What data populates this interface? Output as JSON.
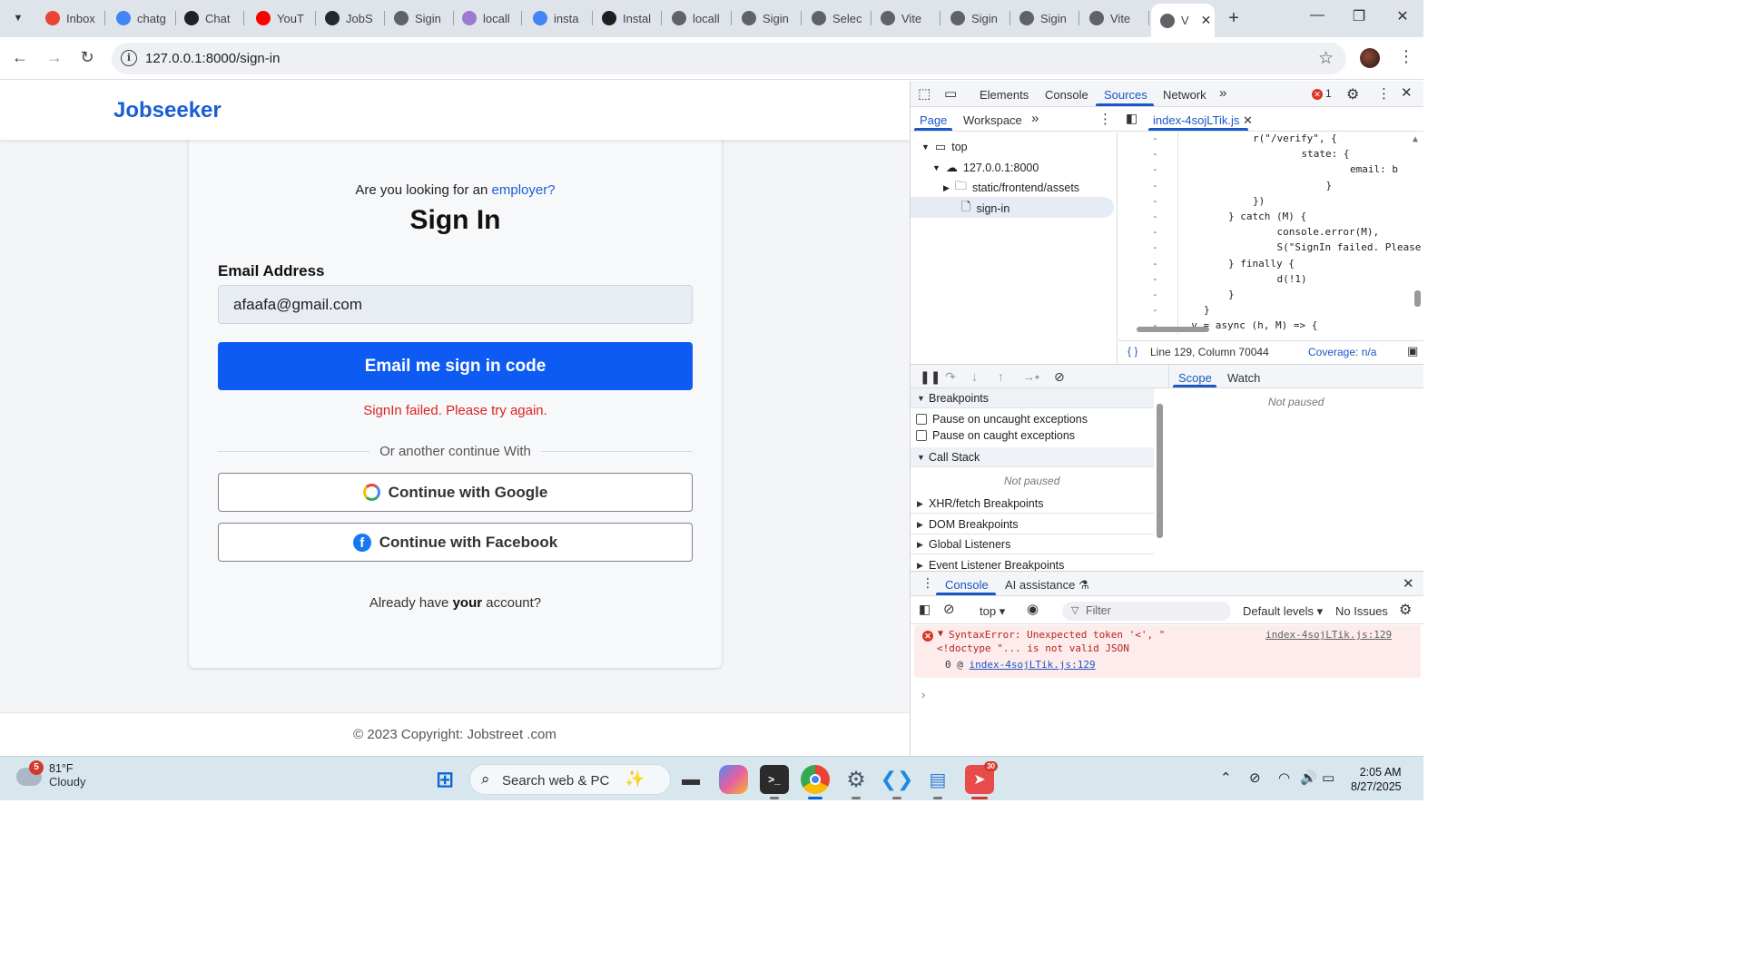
{
  "browser": {
    "tabs": [
      {
        "label": "Inbox",
        "icon": "gmail-icon",
        "color": "#ea4335"
      },
      {
        "label": "chatg",
        "icon": "google-icon",
        "color": "#4285f4"
      },
      {
        "label": "Chat",
        "icon": "openai-icon",
        "color": "#202123"
      },
      {
        "label": "YouT",
        "icon": "youtube-icon",
        "color": "#ff0000"
      },
      {
        "label": "JobS",
        "icon": "github-icon",
        "color": "#24292f"
      },
      {
        "label": "Sigin",
        "icon": "globe-icon",
        "color": "#5f6368"
      },
      {
        "label": "locall",
        "icon": "vite-icon",
        "color": "#9a7bd0"
      },
      {
        "label": "insta",
        "icon": "google-icon",
        "color": "#4285f4"
      },
      {
        "label": "Instal",
        "icon": "render-icon",
        "color": "#1e1e1e"
      },
      {
        "label": "locall",
        "icon": "globe-icon",
        "color": "#5f6368"
      },
      {
        "label": "Sigin",
        "icon": "globe-icon",
        "color": "#5f6368"
      },
      {
        "label": "Selec",
        "icon": "globe-icon",
        "color": "#5f6368"
      },
      {
        "label": "Vite",
        "icon": "globe-icon",
        "color": "#5f6368"
      },
      {
        "label": "Sigin",
        "icon": "globe-icon",
        "color": "#5f6368"
      },
      {
        "label": "Sigin",
        "icon": "globe-icon",
        "color": "#5f6368"
      },
      {
        "label": "Vite",
        "icon": "globe-icon",
        "color": "#5f6368"
      }
    ],
    "active_tab": {
      "label": "V",
      "icon": "globe-icon"
    },
    "url": "127.0.0.1:8000/sign-in"
  },
  "site": {
    "brand": "Jobseeker",
    "question_prefix": "Are you looking for an ",
    "question_link": "employer?",
    "title": "Sign In",
    "email_label": "Email Address",
    "email_value": "afaafa@gmail.com",
    "primary_button": "Email me sign in code",
    "error": "SignIn failed. Please try again.",
    "divider_text": "Or another continue With",
    "google_button": "Continue with Google",
    "facebook_button": "Continue with Facebook",
    "already_prefix": "Already have ",
    "already_bold": "your",
    "already_suffix": " account?",
    "footer": "© 2023 Copyright: Jobstreet .com",
    "accent_color": "#0d5bf2",
    "brand_color": "#1a5ed8",
    "error_color": "#dd2222"
  },
  "devtools": {
    "tabs": [
      "Elements",
      "Console",
      "Sources",
      "Network"
    ],
    "active_tab": "Sources",
    "error_count": "1",
    "nav_tabs": [
      "Page",
      "Workspace"
    ],
    "open_file": "index-4sojLTik.js",
    "tree": {
      "top": "top",
      "origin": "127.0.0.1:8000",
      "folder": "static/frontend/assets",
      "file": "sign-in"
    },
    "code_lines": [
      {
        "dash": "-",
        "code": "r(\"/verify\", {"
      },
      {
        "dash": "-",
        "code": "    state: {"
      },
      {
        "dash": "-",
        "code": "        email: b"
      },
      {
        "dash": "-",
        "code": "    }"
      },
      {
        "dash": "-",
        "code": "})"
      },
      {
        "dash": "-",
        "code": "} catch (M) {"
      },
      {
        "dash": "-",
        "code": "    console.error(M),"
      },
      {
        "dash": "-",
        "code": "    S(\"SignIn failed. Please t"
      },
      {
        "dash": "-",
        "code": "} finally {"
      },
      {
        "dash": "-",
        "code": "    d(!1)"
      },
      {
        "dash": "-",
        "code": "}"
      },
      {
        "dash": "-",
        "code": "}"
      },
      {
        "dash": "-",
        "code": ", v = async (h, M) => {"
      }
    ],
    "cursor_position": "Line 129, Column 70044",
    "coverage": "Coverage: n/a",
    "scope_tabs": [
      "Scope",
      "Watch"
    ],
    "scope_status": "Not paused",
    "breakpoints_header": "Breakpoints",
    "pause_uncaught": "Pause on uncaught exceptions",
    "pause_caught": "Pause on caught exceptions",
    "call_stack_header": "Call Stack",
    "call_stack_status": "Not paused",
    "sections": [
      "XHR/fetch Breakpoints",
      "DOM Breakpoints",
      "Global Listeners",
      "Event Listener Breakpoints"
    ],
    "drawer_tabs": [
      "Console",
      "AI assistance"
    ],
    "context": "top",
    "filter_placeholder": "Filter",
    "levels": "Default levels",
    "issues": "No Issues",
    "error_line1": "SyntaxError: Unexpected token '<', \"",
    "error_line2": "<!doctype \"... is not valid JSON",
    "error_source": "index-4sojLTik.js:129",
    "error_frame_prefix": "0 @ ",
    "error_frame_link": "index-4sojLTik.js:129"
  },
  "taskbar": {
    "weather_temp": "81°F",
    "weather_cond": "Cloudy",
    "weather_badge": "5",
    "search_text": "Search web & PC",
    "telegram_badge": "30",
    "time": "2:05 AM",
    "date": "8/27/2025"
  }
}
